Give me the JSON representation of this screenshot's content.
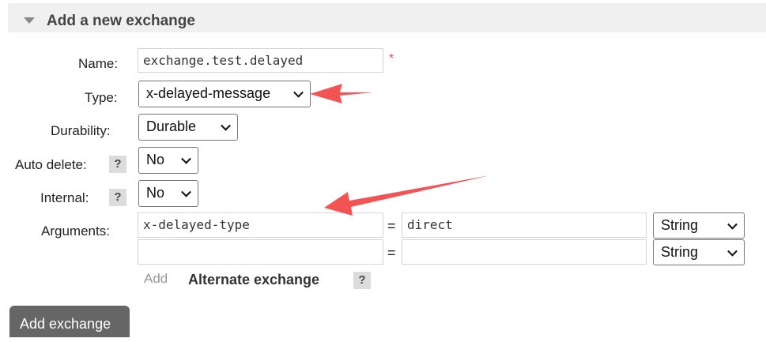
{
  "section": {
    "title": "Add a new exchange"
  },
  "form": {
    "name_label": "Name:",
    "name_value": "exchange.test.delayed",
    "required_mark": "*",
    "type_label": "Type:",
    "type_value": "x-delayed-message",
    "durability_label": "Durability:",
    "durability_value": "Durable",
    "auto_delete_label": "Auto delete:",
    "auto_delete_value": "No",
    "internal_label": "Internal:",
    "internal_value": "No",
    "arguments_label": "Arguments:",
    "help_mark": "?",
    "equals": "=",
    "arguments": [
      {
        "key": "x-delayed-type",
        "value": "direct",
        "type": "String"
      },
      {
        "key": "",
        "value": "",
        "type": "String"
      }
    ],
    "add_label": "Add",
    "alternate_exchange_label": "Alternate exchange"
  },
  "submit_label": "Add exchange",
  "colors": {
    "annotation_arrow": "#f25454",
    "section_bg": "#f0f0f0",
    "button_bg": "#666666"
  }
}
